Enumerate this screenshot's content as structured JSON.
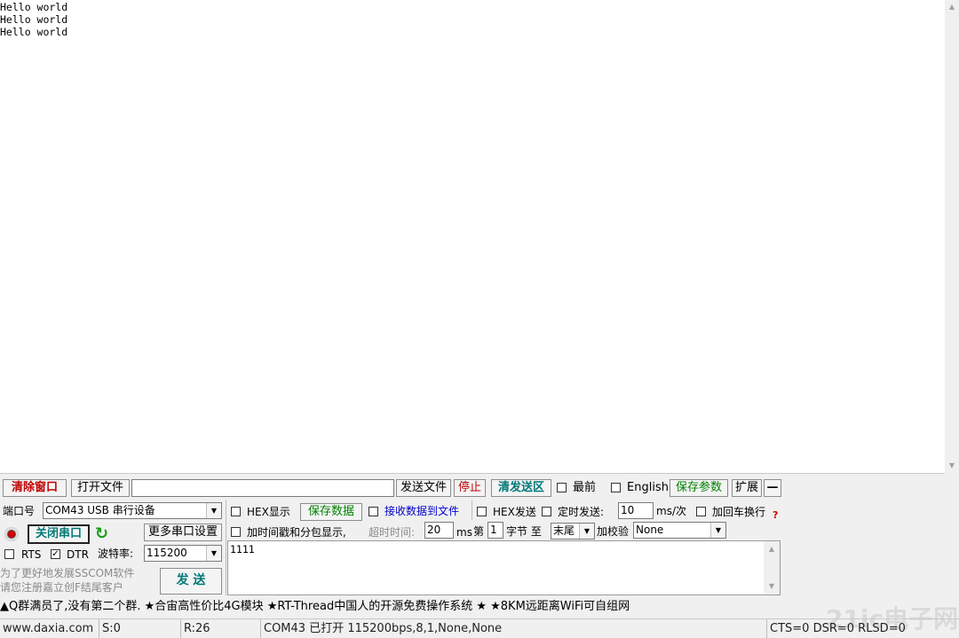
{
  "receive": {
    "text": "Hello world\nHello world\nHello world"
  },
  "toolbar": {
    "clear_window": "清除窗口",
    "open_file": "打开文件",
    "file_path": "",
    "send_file": "发送文件",
    "stop": "停止",
    "clear_send": "清发送区",
    "topmost_label": "最前",
    "english_label": "English",
    "save_params": "保存参数",
    "expand": "扩展",
    "collapse": "—"
  },
  "port": {
    "label": "端口号",
    "value": "COM43 USB 串行设备",
    "close_port": "关闭串口",
    "more_settings": "更多串口设置",
    "rts_label": "RTS",
    "dtr_label": "DTR",
    "baud_label": "波特率:",
    "baud_value": "115200"
  },
  "options": {
    "hex_display": "HEX显示",
    "save_data": "保存数据",
    "recv_to_file": "接收数据到文件",
    "hex_send": "HEX发送",
    "timed_send": "定时发送:",
    "interval": "10",
    "interval_unit": "ms/次",
    "add_crlf": "加回车换行",
    "timestamp": "加时间戳和分包显示,",
    "timeout_label": "超时时间:",
    "timeout_value": "20",
    "timeout_unit": "ms",
    "byte_prefix": "第",
    "byte_index": "1",
    "byte_mid": "字节 至",
    "byte_end": "末尾",
    "checksum_label": "加校验",
    "checksum_value": "None"
  },
  "promo": {
    "line1": "为了更好地发展SSCOM软件",
    "line2": "请您注册嘉立创F结尾客户"
  },
  "send": {
    "button": "发 送",
    "text": "1111"
  },
  "ticker": "▲Q群满员了,没有第二个群. ★合宙高性价比4G模块 ★RT-Thread中国人的开源免费操作系统 ★ ★8KM远距离WiFi可自组网",
  "status": {
    "website": "www.daxia.com",
    "sent": "S:0",
    "received": "R:26",
    "port_state": "COM43 已打开  115200bps,8,1,None,None",
    "lines": "CTS=0 DSR=0 RLSD=0"
  },
  "watermark": "21ic电子网"
}
